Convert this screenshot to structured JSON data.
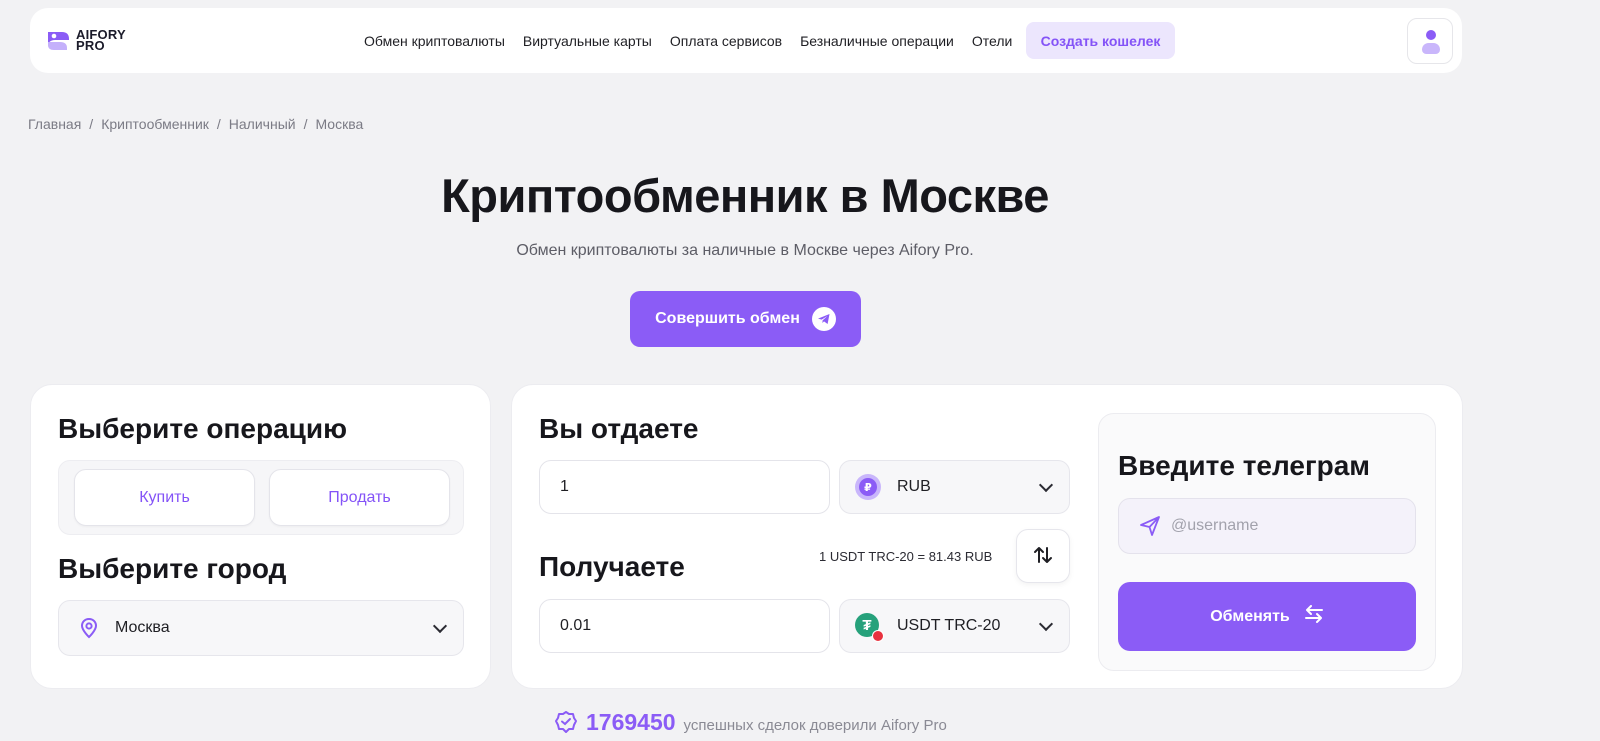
{
  "brand": {
    "name_line1": "AIFORY",
    "name_line2": "PRO",
    "accent": "#8b5cf6"
  },
  "nav": {
    "items": [
      {
        "label": "Обмен криптовалюты"
      },
      {
        "label": "Виртуальные карты"
      },
      {
        "label": "Оплата сервисов"
      },
      {
        "label": "Безналичные операции"
      },
      {
        "label": "Отели"
      }
    ],
    "create_wallet": "Создать кошелек"
  },
  "breadcrumb": [
    "Главная",
    "Криптообменник",
    "Наличный",
    "Москва"
  ],
  "hero": {
    "title": "Криптообменник в Москве",
    "subtitle": "Обмен криптовалюты за наличные в Москве через Aifory Pro.",
    "cta": "Совершить обмен"
  },
  "operation": {
    "title": "Выберите операцию",
    "buy": "Купить",
    "sell": "Продать"
  },
  "city": {
    "title": "Выберите город",
    "selected": "Москва"
  },
  "give": {
    "title": "Вы отдаете",
    "amount": "1",
    "currency": "RUB",
    "currency_symbol": "₽"
  },
  "receive": {
    "title": "Получаете",
    "amount": "0.01",
    "currency": "USDT TRC-20",
    "currency_symbol": "₮"
  },
  "rate": "1 USDT TRC-20 = 81.43 RUB",
  "telegram": {
    "title": "Введите телеграм",
    "placeholder": "@username",
    "submit": "Обменять"
  },
  "stats": {
    "count": "1769450",
    "text": "успешных сделок доверили Aifory Pro"
  },
  "icons": {
    "logo": "aifory-logo-icon",
    "user": "user-icon",
    "telegram": "telegram-icon",
    "location": "location-pin-icon",
    "swap": "swap-vertical-icon",
    "exchange": "exchange-arrows-icon",
    "verified": "verified-badge-icon"
  }
}
